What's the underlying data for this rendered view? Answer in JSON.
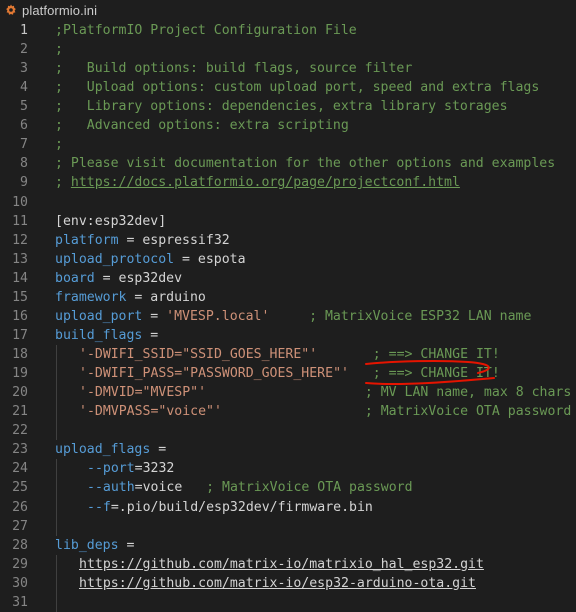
{
  "tab": {
    "title": "platformio.ini",
    "icon": "gear-icon",
    "icon_color": "#e37933"
  },
  "lines": [
    {
      "n": "1",
      "t": ";PlatformIO Project Configuration File"
    },
    {
      "n": "2",
      "t": ";"
    },
    {
      "n": "3",
      "t": ";   Build options: build flags, source filter"
    },
    {
      "n": "4",
      "t": ";   Upload options: custom upload port, speed and extra flags"
    },
    {
      "n": "5",
      "t": ";   Library options: dependencies, extra library storages"
    },
    {
      "n": "6",
      "t": ";   Advanced options: extra scripting"
    },
    {
      "n": "7",
      "t": ";"
    },
    {
      "n": "8",
      "t": "; Please visit documentation for the other options and examples"
    },
    {
      "n": "9",
      "a": "; ",
      "b": "https://docs.platformio.org/page/projectconf.html"
    },
    {
      "n": "10"
    },
    {
      "n": "11",
      "t": "[env:esp32dev]"
    },
    {
      "n": "12",
      "k": "platform",
      "e": " = ",
      "v": "espressif32"
    },
    {
      "n": "13",
      "k": "upload_protocol",
      "e": " = ",
      "v": "espota"
    },
    {
      "n": "14",
      "k": "board",
      "e": " = ",
      "v": "esp32dev"
    },
    {
      "n": "15",
      "k": "framework",
      "e": " = ",
      "v": "arduino"
    },
    {
      "n": "16",
      "k": "upload_port",
      "e": " = ",
      "s": "'MVESP.local'",
      "gap": "     ",
      "c": "; MatrixVoice ESP32 LAN name"
    },
    {
      "n": "17",
      "k": "build_flags",
      "e": " ="
    },
    {
      "n": "18",
      "s": "'-DWIFI_SSID=\"SSID_GOES_HERE\"'",
      "gap": "       ",
      "c": "; ==> CHANGE IT!"
    },
    {
      "n": "19",
      "s": "'-DWIFI_PASS=\"PASSWORD_GOES_HERE\"'",
      "gap": "   ",
      "c": "; ==> CHANGE IT!"
    },
    {
      "n": "20",
      "s": "'-DMVID=\"MVESP\"'",
      "gap": "                    ",
      "c": "; MV LAN name, max 8 chars"
    },
    {
      "n": "21",
      "s": "'-DMVPASS=\"voice\"'",
      "gap": "                  ",
      "c": "; MatrixVoice OTA password"
    },
    {
      "n": "22"
    },
    {
      "n": "23",
      "k": "upload_flags",
      "e": " ="
    },
    {
      "n": "24",
      "k2": "--port",
      "e": "=",
      "v": "3232"
    },
    {
      "n": "25",
      "k2": "--auth",
      "e": "=",
      "v": "voice",
      "gap": "   ",
      "c": "; MatrixVoice OTA password"
    },
    {
      "n": "26",
      "k2": "--f",
      "e": "=",
      "v": ".pio/build/esp32dev/firmware.bin"
    },
    {
      "n": "27"
    },
    {
      "n": "28",
      "k": "lib_deps",
      "e": " ="
    },
    {
      "n": "29",
      "u": "https://github.com/matrix-io/matrixio_hal_esp32.git"
    },
    {
      "n": "30",
      "u": "https://github.com/matrix-io/esp32-arduino-ota.git"
    },
    {
      "n": "31"
    }
  ],
  "annotation_color": "#e51400"
}
